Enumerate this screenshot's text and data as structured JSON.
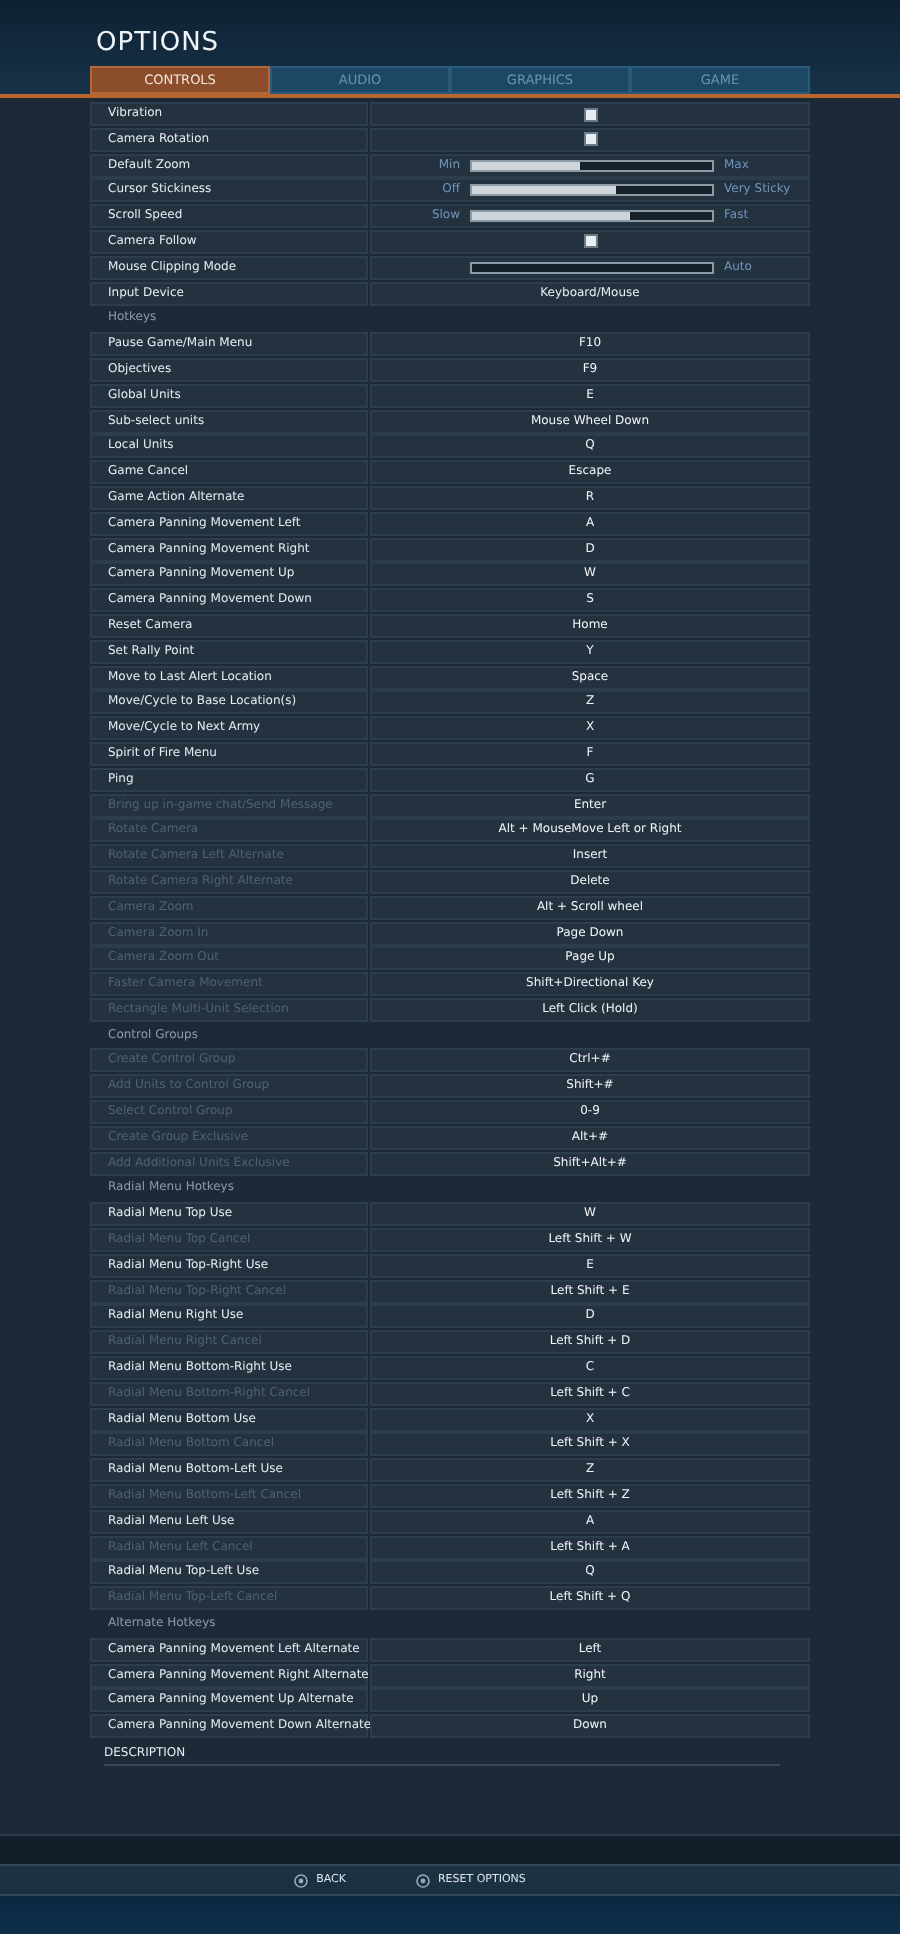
{
  "title": "OPTIONS",
  "tabs": [
    {
      "label": "CONTROLS",
      "selected": true
    },
    {
      "label": "AUDIO",
      "selected": false
    },
    {
      "label": "GRAPHICS",
      "selected": false
    },
    {
      "label": "GAME",
      "selected": false
    }
  ],
  "settings": [
    {
      "kind": "checkbox",
      "label": "Vibration",
      "checked": true
    },
    {
      "kind": "checkbox",
      "label": "Camera Rotation",
      "checked": true
    },
    {
      "kind": "slider",
      "label": "Default Zoom",
      "min": "Min",
      "max": "Max",
      "level": 0.45
    },
    {
      "kind": "slider",
      "label": "Cursor Stickiness",
      "min": "Off",
      "max": "Very Sticky",
      "level": 0.6
    },
    {
      "kind": "slider",
      "label": "Scroll Speed",
      "min": "Slow",
      "max": "Fast",
      "level": 0.66
    },
    {
      "kind": "checkbox",
      "label": "Camera Follow",
      "checked": true
    },
    {
      "kind": "empty_slider",
      "label": "Mouse Clipping Mode",
      "max": "Auto"
    },
    {
      "kind": "select",
      "label": "Input Device",
      "value": "Keyboard/Mouse"
    }
  ],
  "hotkey_groups": [
    {
      "title": "Hotkeys",
      "bindings": [
        {
          "action": "Pause Game/Main Menu",
          "key": "F10",
          "disabled": false
        },
        {
          "action": "Objectives",
          "key": "F9",
          "disabled": false
        },
        {
          "action": "Global Units",
          "key": "E",
          "disabled": false
        },
        {
          "action": "Sub-select units",
          "key": "Mouse Wheel Down",
          "disabled": false
        },
        {
          "action": "Local Units",
          "key": "Q",
          "disabled": false
        },
        {
          "action": "Game Cancel",
          "key": "Escape",
          "disabled": false
        },
        {
          "action": "Game Action Alternate",
          "key": "R",
          "disabled": false
        },
        {
          "action": "Camera Panning Movement Left",
          "key": "A",
          "disabled": false
        },
        {
          "action": "Camera Panning Movement Right",
          "key": "D",
          "disabled": false
        },
        {
          "action": "Camera Panning Movement Up",
          "key": "W",
          "disabled": false
        },
        {
          "action": "Camera Panning Movement Down",
          "key": "S",
          "disabled": false
        },
        {
          "action": "Reset Camera",
          "key": "Home",
          "disabled": false
        },
        {
          "action": "Set Rally Point",
          "key": "Y",
          "disabled": false
        },
        {
          "action": "Move to Last Alert Location",
          "key": "Space",
          "disabled": false
        },
        {
          "action": "Move/Cycle to Base Location(s)",
          "key": "Z",
          "disabled": false
        },
        {
          "action": "Move/Cycle to Next Army",
          "key": "X",
          "disabled": false
        },
        {
          "action": "Spirit of Fire Menu",
          "key": "F",
          "disabled": false
        },
        {
          "action": "Ping",
          "key": "G",
          "disabled": false
        },
        {
          "action": "Bring up in-game chat/Send Message",
          "key": "Enter",
          "disabled": true
        },
        {
          "action": "Rotate Camera",
          "key": "Alt + MouseMove Left or Right",
          "disabled": true
        },
        {
          "action": "Rotate Camera Left Alternate",
          "key": "Insert",
          "disabled": true
        },
        {
          "action": "Rotate Camera Right Alternate",
          "key": "Delete",
          "disabled": true
        },
        {
          "action": "Camera Zoom",
          "key": "Alt + Scroll wheel",
          "disabled": true
        },
        {
          "action": "Camera Zoom In",
          "key": "Page Down",
          "disabled": true
        },
        {
          "action": "Camera Zoom Out",
          "key": "Page Up",
          "disabled": true
        },
        {
          "action": "Faster Camera Movement",
          "key": "Shift+Directional Key",
          "disabled": true
        },
        {
          "action": "Rectangle Multi-Unit Selection",
          "key": "Left Click (Hold)",
          "disabled": true
        }
      ]
    },
    {
      "title": "Control Groups",
      "bindings": [
        {
          "action": "Create Control Group",
          "key": "Ctrl+#",
          "disabled": true
        },
        {
          "action": "Add Units to Control Group",
          "key": "Shift+#",
          "disabled": true
        },
        {
          "action": "Select Control Group",
          "key": "0-9",
          "disabled": true
        },
        {
          "action": "Create Group Exclusive",
          "key": "Alt+#",
          "disabled": true
        },
        {
          "action": "Add Additional Units Exclusive",
          "key": "Shift+Alt+#",
          "disabled": true
        }
      ]
    },
    {
      "title": "Radial Menu Hotkeys",
      "bindings": [
        {
          "action": "Radial Menu Top Use",
          "key": "W",
          "disabled": false
        },
        {
          "action": "Radial Menu Top Cancel",
          "key": "Left Shift + W",
          "disabled": true
        },
        {
          "action": "Radial Menu Top-Right Use",
          "key": "E",
          "disabled": false
        },
        {
          "action": "Radial Menu Top-Right Cancel",
          "key": "Left Shift + E",
          "disabled": true
        },
        {
          "action": "Radial Menu Right Use",
          "key": "D",
          "disabled": false
        },
        {
          "action": "Radial Menu Right Cancel",
          "key": "Left Shift + D",
          "disabled": true
        },
        {
          "action": "Radial Menu Bottom-Right Use",
          "key": "C",
          "disabled": false
        },
        {
          "action": "Radial Menu Bottom-Right Cancel",
          "key": "Left Shift + C",
          "disabled": true
        },
        {
          "action": "Radial Menu Bottom Use",
          "key": "X",
          "disabled": false
        },
        {
          "action": "Radial Menu Bottom Cancel",
          "key": "Left Shift + X",
          "disabled": true
        },
        {
          "action": "Radial Menu Bottom-Left Use",
          "key": "Z",
          "disabled": false
        },
        {
          "action": "Radial Menu Bottom-Left Cancel",
          "key": "Left Shift + Z",
          "disabled": true
        },
        {
          "action": "Radial Menu Left Use",
          "key": "A",
          "disabled": false
        },
        {
          "action": "Radial Menu Left Cancel",
          "key": "Left Shift + A",
          "disabled": true
        },
        {
          "action": "Radial Menu Top-Left Use",
          "key": "Q",
          "disabled": false
        },
        {
          "action": "Radial Menu Top-Left Cancel",
          "key": "Left Shift + Q",
          "disabled": true
        }
      ]
    },
    {
      "title": "Alternate Hotkeys",
      "bindings": [
        {
          "action": "Camera Panning Movement Left Alternate",
          "key": "Left",
          "disabled": false
        },
        {
          "action": "Camera Panning Movement Right Alternate",
          "key": "Right",
          "disabled": false
        },
        {
          "action": "Camera Panning Movement Up Alternate",
          "key": "Up",
          "disabled": false
        },
        {
          "action": "Camera Panning Movement Down Alternate",
          "key": "Down",
          "disabled": false
        }
      ]
    }
  ],
  "description": {
    "heading": "DESCRIPTION"
  },
  "footer_buttons": [
    {
      "label": "BACK"
    },
    {
      "label": "RESET OPTIONS"
    }
  ]
}
